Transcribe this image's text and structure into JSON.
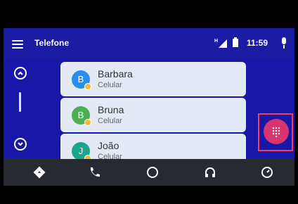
{
  "app": {
    "title": "Telefone"
  },
  "status": {
    "time": "11:59"
  },
  "contacts": [
    {
      "initial": "B",
      "name": "Barbara",
      "type": "Celular",
      "avatar_color": "#2a8df0"
    },
    {
      "initial": "B",
      "name": "Bruna",
      "type": "Celular",
      "avatar_color": "#4caf50"
    },
    {
      "initial": "J",
      "name": "João",
      "type": "Celular",
      "avatar_color": "#1aa58f"
    }
  ],
  "icons": {
    "top": [
      "menu-icon",
      "signal-icon",
      "battery-icon",
      "microphone-icon"
    ],
    "side": [
      "chevron-up-icon",
      "chevron-down-icon"
    ],
    "dialer": "dialpad-icon",
    "bottom": [
      "navigation-icon",
      "phone-icon",
      "home-circle-icon",
      "headphones-icon",
      "recent-icon"
    ]
  },
  "colors": {
    "primary": "#1818a8",
    "card": "#e4e9f6",
    "accent": "#d9346f",
    "highlight": "#ff3c54",
    "bottom_bar": "#272a31"
  }
}
